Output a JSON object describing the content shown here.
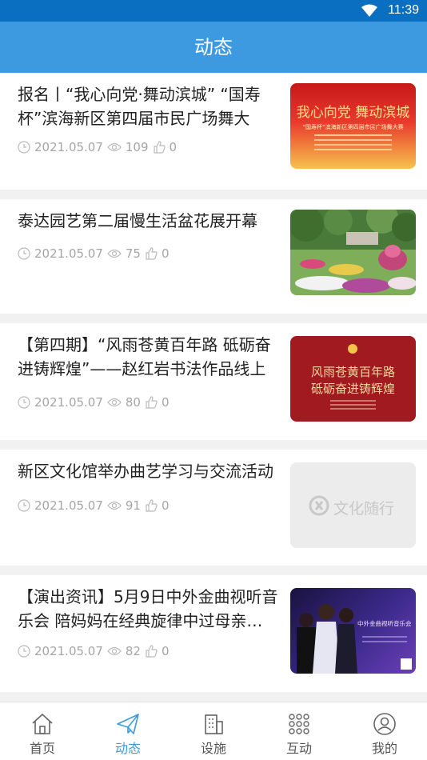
{
  "status_bar": {
    "time": "11:39"
  },
  "header": {
    "title": "动态"
  },
  "feed": [
    {
      "title": "报名丨“我心向党·舞动滨城” “国寿杯”滨海新区第四届市民广场舞大赛…",
      "date": "2021.05.07",
      "views": "109",
      "likes": "0",
      "thumb": {
        "type": "poster-red",
        "line1": "我心向党 舞动滨城",
        "line2": "“国寿杯”滨海新区第四届市民广场舞大赛"
      }
    },
    {
      "title": "泰达园艺第二届慢生活盆花展开幕",
      "date": "2021.05.07",
      "views": "75",
      "likes": "0",
      "thumb": {
        "type": "garden-photo"
      }
    },
    {
      "title": "【第四期】“风雨苍黄百年路 砥砺奋进铸辉煌”——赵红岩书法作品线上展",
      "date": "2021.05.07",
      "views": "80",
      "likes": "0",
      "thumb": {
        "type": "calligraphy-red",
        "line1": "风雨苍黄百年路",
        "line2": "砥砺奋进铸辉煌"
      }
    },
    {
      "title": "新区文化馆举办曲艺学习与交流活动",
      "date": "2021.05.07",
      "views": "91",
      "likes": "0",
      "thumb": {
        "type": "placeholder",
        "text": "文化随行"
      }
    },
    {
      "title": "【演出资讯】5月9日中外金曲视听音乐会 陪妈妈在经典旋律中过母亲…",
      "date": "2021.05.07",
      "views": "82",
      "likes": "0",
      "thumb": {
        "type": "concert-purple",
        "line1": "中外金曲视听音乐会"
      }
    }
  ],
  "tabbar": [
    {
      "label": "首页",
      "icon": "home-icon",
      "active": false
    },
    {
      "label": "动态",
      "icon": "paper-plane-icon",
      "active": true
    },
    {
      "label": "设施",
      "icon": "building-icon",
      "active": false
    },
    {
      "label": "互动",
      "icon": "grid-dots-icon",
      "active": false
    },
    {
      "label": "我的",
      "icon": "user-circle-icon",
      "active": false
    }
  ],
  "colors": {
    "header": "#3d99e0",
    "statusbar": "#0a6fc0",
    "active_tab": "#3d99e0",
    "meta_text": "#a5a5a5"
  }
}
